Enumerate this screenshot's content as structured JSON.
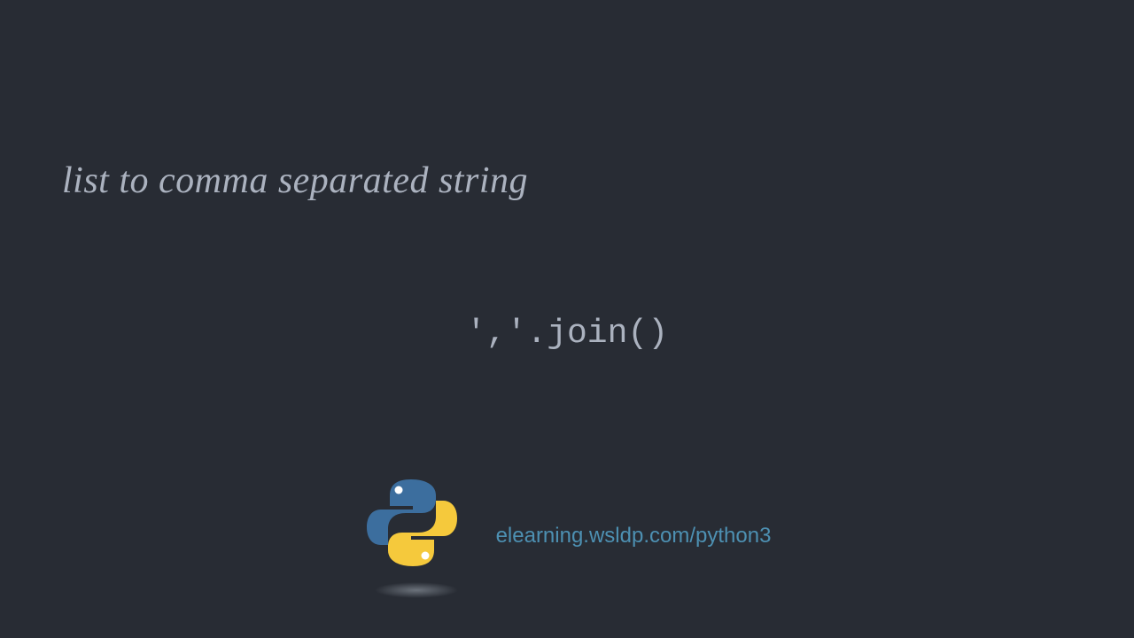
{
  "title": "list to comma separated string",
  "code": "','.join()",
  "url": "elearning.wsldp.com/python3"
}
